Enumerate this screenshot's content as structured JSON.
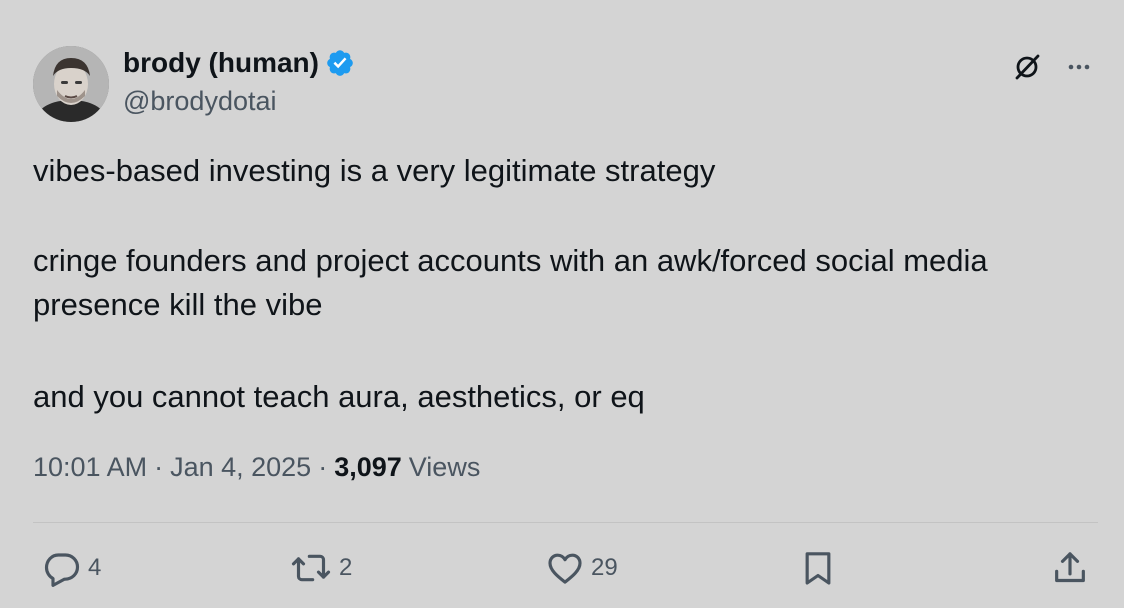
{
  "author": {
    "name": "brody (human)",
    "handle": "@brodydotai",
    "verified": true,
    "verified_color": "#1d9bf0"
  },
  "header_icons": {
    "grok": "grok-icon",
    "more": "more-icon"
  },
  "tweet": {
    "paragraph_1": "vibes-based investing is a very legitimate strategy",
    "paragraph_2_line_1": "cringe founders and project accounts with an awk/forced social media",
    "paragraph_2_line_2": "presence kill the vibe",
    "paragraph_3": "and you cannot teach aura, aesthetics, or eq"
  },
  "meta": {
    "time": "10:01 AM",
    "separator": "·",
    "date": "Jan 4, 2025",
    "views_count": "3,097",
    "views_label": "Views"
  },
  "actions": {
    "replies": "4",
    "reposts": "2",
    "likes": "29",
    "reply_icon": "reply-icon",
    "repost_icon": "repost-icon",
    "like_icon": "heart-icon",
    "bookmark_icon": "bookmark-icon",
    "share_icon": "share-icon"
  },
  "colors": {
    "background": "#d4d4d4",
    "text_primary": "#0f1419",
    "text_secondary": "#4a5560"
  }
}
